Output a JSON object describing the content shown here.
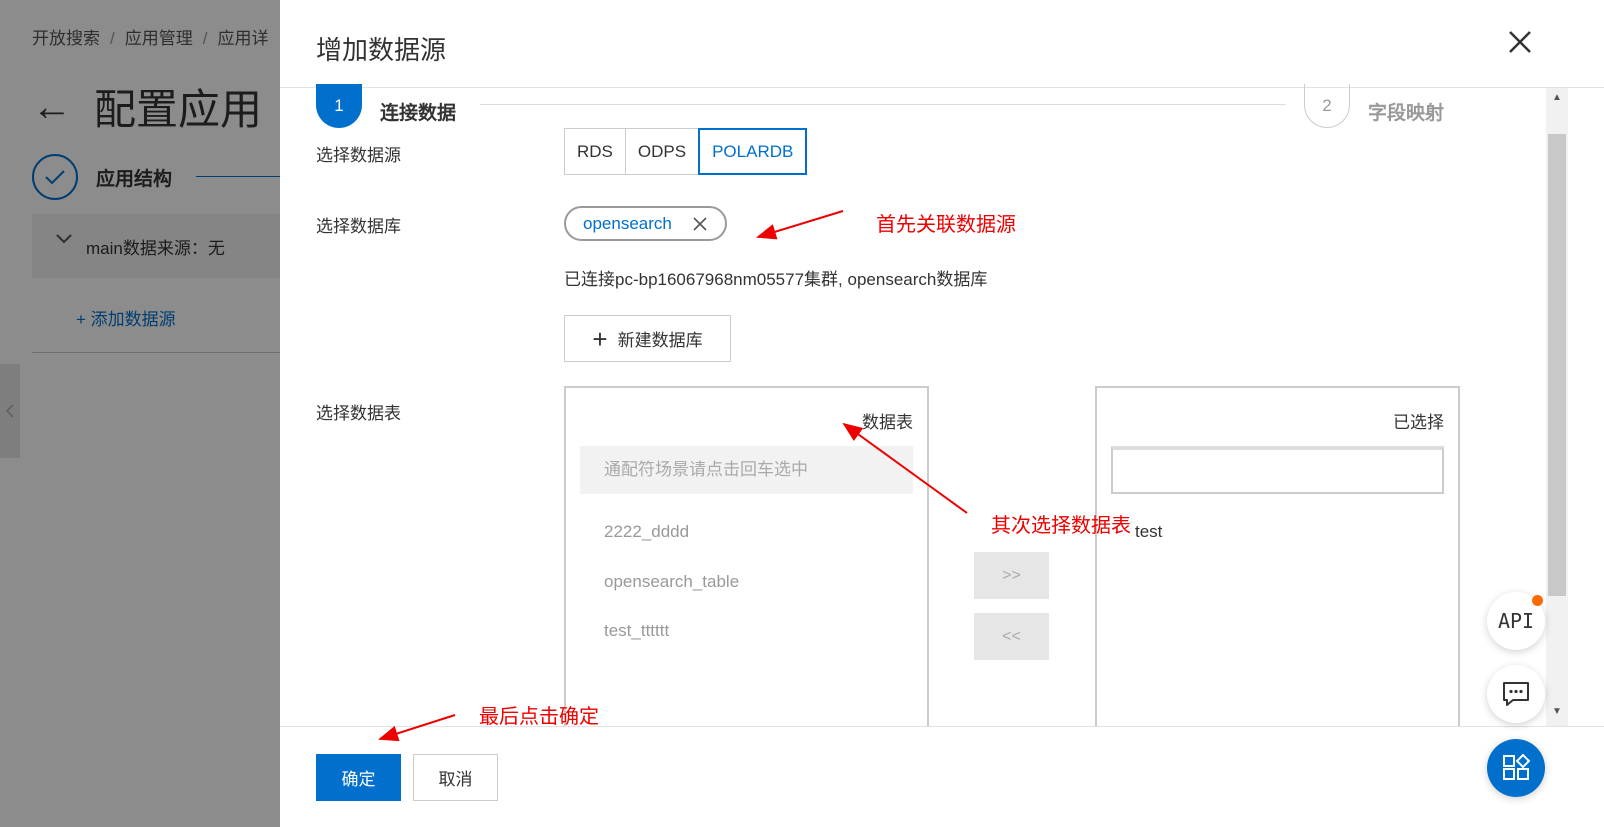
{
  "background": {
    "breadcrumb": [
      "开放搜索",
      "应用管理",
      "应用详"
    ],
    "breadcrumb_sep": "/",
    "back_arrow": "←",
    "page_title": "配置应用",
    "step_label": "应用结构",
    "panel_label": "main数据来源：无",
    "add_source_label": "添加数据源"
  },
  "drawer": {
    "title": "增加数据源",
    "close_symbol": "✕",
    "steps": [
      {
        "number": "1",
        "label": "连接数据"
      },
      {
        "number": "2",
        "label": "字段映射"
      }
    ],
    "form": {
      "source_label": "选择数据源",
      "source_options": [
        "RDS",
        "ODPS",
        "POLARDB"
      ],
      "source_selected": "POLARDB",
      "database_label": "选择数据库",
      "database_tag": "opensearch",
      "connected_text": "已连接pc-bp16067968nm05577集群, opensearch数据库",
      "new_db_button": "新建数据库",
      "table_label": "选择数据表",
      "transfer_left": {
        "title": "数据表",
        "search_placeholder": "通配符场景请点击回车选中",
        "items": [
          "2222_dddd",
          "opensearch_table",
          "test_tttttt"
        ]
      },
      "transfer_right": {
        "title": "已选择",
        "items": [
          "test"
        ]
      },
      "move_right": ">>",
      "move_left": "<<"
    },
    "footer": {
      "ok_label": "确定",
      "cancel_label": "取消"
    }
  },
  "floating": {
    "api_label": "API"
  },
  "annotations": {
    "first": "首先关联数据源",
    "second": "其次选择数据表",
    "last": "最后点击确定"
  },
  "colors": {
    "primary": "#0070cc",
    "annotation": "#e00000",
    "badge": "#ff6a00"
  }
}
